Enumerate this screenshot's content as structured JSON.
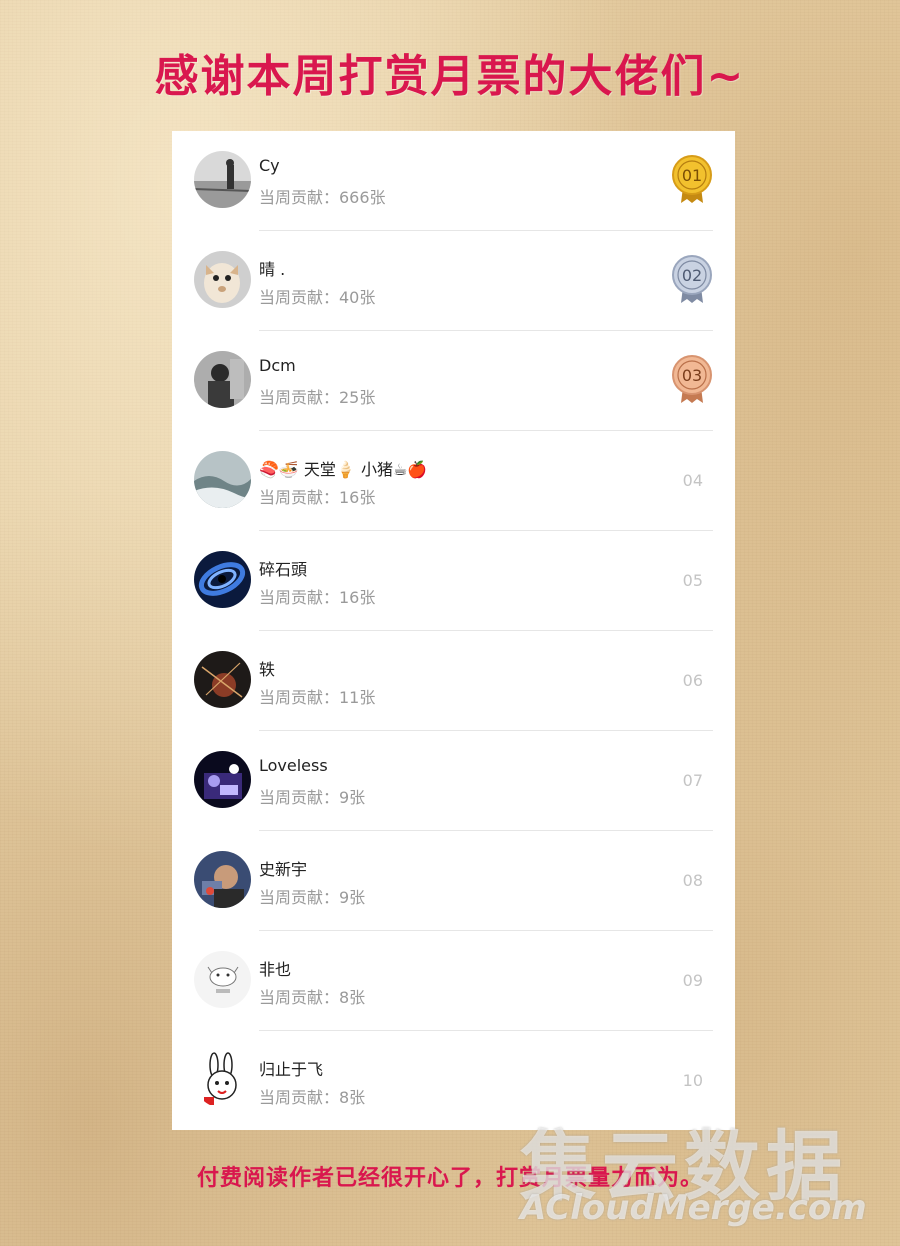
{
  "header": {
    "title": "感谢本周打赏月票的大佬们~"
  },
  "list": {
    "items": [
      {
        "name": "Cy",
        "contribution": "当周贡献：666张",
        "rank": "01",
        "medal": "gold"
      },
      {
        "name": "晴 .",
        "contribution": "当周贡献：40张",
        "rank": "02",
        "medal": "silver"
      },
      {
        "name": "Dcm",
        "contribution": "当周贡献：25张",
        "rank": "03",
        "medal": "bronze"
      },
      {
        "name": "🍣🍜 天堂🍦 小猪☕🍎",
        "contribution": "当周贡献：16张",
        "rank": "04"
      },
      {
        "name": "碎石頭",
        "contribution": "当周贡献：16张",
        "rank": "05"
      },
      {
        "name": "轶",
        "contribution": "当周贡献：11张",
        "rank": "06"
      },
      {
        "name": "Loveless",
        "contribution": "当周贡献：9张",
        "rank": "07"
      },
      {
        "name": "史新宇",
        "contribution": "当周贡献：9张",
        "rank": "08"
      },
      {
        "name": "非也",
        "contribution": "当周贡献：8张",
        "rank": "09"
      },
      {
        "name": "归止于飞",
        "contribution": "当周贡献：8张",
        "rank": "10"
      }
    ]
  },
  "footer": {
    "text": "付费阅读作者已经很开心了，打赏月票量力而为。"
  },
  "watermark": {
    "cn": "集云数据",
    "en": "ACloudMerge.com"
  },
  "colors": {
    "accent": "#d9174e",
    "gold": "#e8b21f",
    "silver": "#a9b4c8",
    "bronze": "#e3a17c"
  }
}
